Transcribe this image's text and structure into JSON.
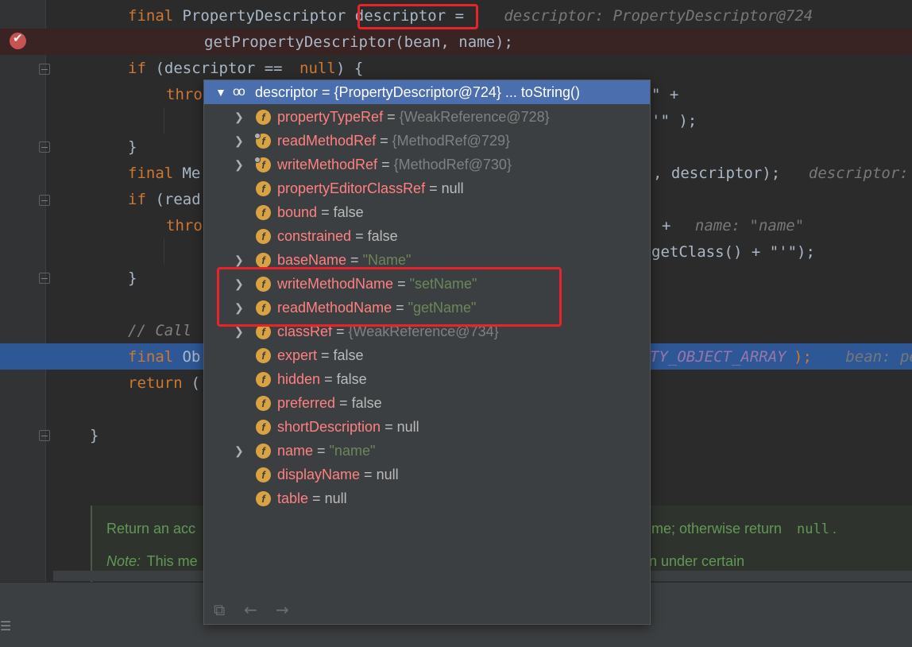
{
  "editor": {
    "lines": [
      {
        "segs": [
          {
            "text": "final",
            "cls": "kw"
          },
          {
            "text": " PropertyDescriptor descriptor ="
          },
          {
            "text": "   descriptor: PropertyDescriptor@724",
            "cls": "hint"
          }
        ]
      },
      {
        "segs": [
          {
            "text": "getPropertyDescriptor(bean, name);"
          }
        ]
      },
      {
        "segs": [
          {
            "text": "if",
            "cls": "kw"
          },
          {
            "text": " (descriptor == "
          },
          {
            "text": "null",
            "cls": "kw"
          },
          {
            "text": ") {"
          }
        ]
      },
      {
        "segs": [
          {
            "text": "thro",
            "cls": "kw"
          }
        ]
      },
      {
        "segs": [
          {
            "text": "\" +"
          }
        ]
      },
      {
        "segs": [
          {
            "text": "'\" );"
          }
        ]
      },
      {
        "segs": [
          {
            "text": "}"
          }
        ]
      },
      {
        "segs": [
          {
            "text": "final",
            "cls": "kw"
          },
          {
            "text": " Me"
          }
        ]
      },
      {
        "segs": [
          {
            "text": ", descriptor);"
          },
          {
            "text": "  descriptor:",
            "cls": "hint"
          }
        ]
      },
      {
        "segs": [
          {
            "text": "if",
            "cls": "kw"
          },
          {
            "text": " (read"
          }
        ]
      },
      {
        "segs": [
          {
            "text": "thro",
            "cls": "kw"
          }
        ]
      },
      {
        "segs": [
          {
            "text": "+"
          },
          {
            "text": "  name: \"name\"",
            "cls": "hint"
          }
        ]
      },
      {
        "segs": [
          {
            "text": "getClass() + \"'\");"
          }
        ]
      },
      {
        "segs": [
          {
            "text": "}"
          }
        ]
      },
      {
        "segs": [
          {
            "text": "// Call",
            "cls": "cmt"
          }
        ]
      },
      {
        "segs": [
          {
            "text": "final",
            "cls": "kw"
          },
          {
            "text": " Ob"
          }
        ]
      },
      {
        "segs": [
          {
            "text": "TY_OBJECT_ARRAY",
            "cls": "const"
          },
          {
            "text": ");"
          },
          {
            "text": "   bean: pe",
            "cls": "hint"
          }
        ]
      },
      {
        "segs": [
          {
            "text": "return",
            "cls": "kw"
          },
          {
            "text": " ("
          }
        ]
      },
      {
        "segs": [
          {
            "text": "}"
          }
        ]
      }
    ],
    "doc": {
      "line1_a": "Return an acc",
      "line1_b": "me; otherwise return ",
      "line1_code": "null",
      "line1_end": ".",
      "line2_note": "Note:",
      "line2_a": " This me",
      "line2_b": "n under certain"
    }
  },
  "popup": {
    "header": {
      "var": "descriptor",
      "eq": " = ",
      "ref": "{PropertyDescriptor@724}",
      "action": " ... toString()"
    },
    "fields": [
      {
        "name": "propertyTypeRef",
        "value": "{WeakReference@728}",
        "kind": "ref",
        "expandable": true,
        "marker": false
      },
      {
        "name": "readMethodRef",
        "value": "{MethodRef@729}",
        "kind": "ref",
        "expandable": true,
        "marker": true
      },
      {
        "name": "writeMethodRef",
        "value": "{MethodRef@730}",
        "kind": "ref",
        "expandable": true,
        "marker": true
      },
      {
        "name": "propertyEditorClassRef",
        "value": "null",
        "kind": "val",
        "expandable": false,
        "marker": false
      },
      {
        "name": "bound",
        "value": "false",
        "kind": "val",
        "expandable": false,
        "marker": false
      },
      {
        "name": "constrained",
        "value": "false",
        "kind": "val",
        "expandable": false,
        "marker": false
      },
      {
        "name": "baseName",
        "value": "\"Name\"",
        "kind": "str",
        "expandable": true,
        "marker": false
      },
      {
        "name": "writeMethodName",
        "value": "\"setName\"",
        "kind": "str",
        "expandable": true,
        "marker": false
      },
      {
        "name": "readMethodName",
        "value": "\"getName\"",
        "kind": "str",
        "expandable": true,
        "marker": false
      },
      {
        "name": "classRef",
        "value": "{WeakReference@734}",
        "kind": "ref",
        "expandable": true,
        "marker": false
      },
      {
        "name": "expert",
        "value": "false",
        "kind": "val",
        "expandable": false,
        "marker": false
      },
      {
        "name": "hidden",
        "value": "false",
        "kind": "val",
        "expandable": false,
        "marker": false
      },
      {
        "name": "preferred",
        "value": "false",
        "kind": "val",
        "expandable": false,
        "marker": false
      },
      {
        "name": "shortDescription",
        "value": "null",
        "kind": "val",
        "expandable": false,
        "marker": false
      },
      {
        "name": "name",
        "value": "\"name\"",
        "kind": "str",
        "expandable": true,
        "marker": false
      },
      {
        "name": "displayName",
        "value": "null",
        "kind": "val",
        "expandable": false,
        "marker": false
      },
      {
        "name": "table",
        "value": "null",
        "kind": "val",
        "expandable": false,
        "marker": false
      }
    ],
    "badge_letter": "f",
    "footer_icons": [
      "pin-to-editor-icon",
      "back-arrow-icon",
      "forward-arrow-icon"
    ]
  },
  "colors": {
    "accent": "#4b6eaf",
    "highlight_box": "#e8232c",
    "field_name": "#ff8080",
    "string_value": "#6a8759"
  }
}
